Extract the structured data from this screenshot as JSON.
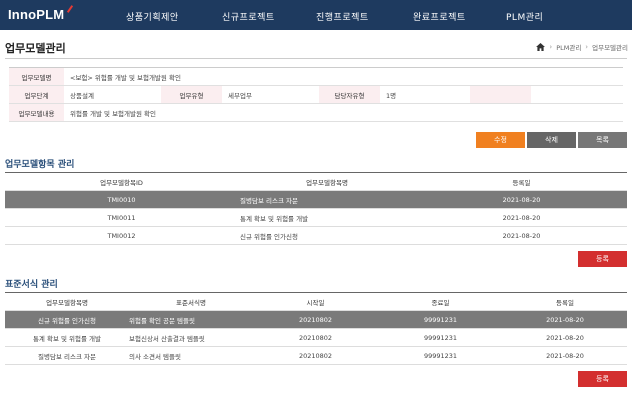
{
  "brand": {
    "logo": "InnoPLM"
  },
  "nav": [
    {
      "label": "상품기획제안"
    },
    {
      "label": "신규프로젝트"
    },
    {
      "label": "진행프로젝트"
    },
    {
      "label": "완료프로젝트"
    },
    {
      "label": "PLM관리"
    }
  ],
  "page": {
    "title": "업무모델관리",
    "breadcrumb": [
      "PLM관리",
      "업무모델관리"
    ]
  },
  "info": {
    "model_name_label": "업무모델명",
    "model_name_value": "<보험> 위험률 개발 및 보험개발원 확인",
    "stage_label": "업무단계",
    "stage_value": "상품설계",
    "type_label": "업무유형",
    "type_value": "세부업무",
    "owner_type_label": "담당자유형",
    "owner_type_value": "1명",
    "content_label": "업무모델내용",
    "content_value": "위험률 개발 및 보험개발원 확인"
  },
  "buttons": {
    "edit": "수정",
    "delete": "삭제",
    "list": "목록",
    "register": "등록"
  },
  "items_section": {
    "title": "업무모델항목 관리",
    "columns": [
      "업무모델항목ID",
      "업무모델항목명",
      "등록일"
    ],
    "rows": [
      [
        "TMI0010",
        "질병담보 리스크 자문",
        "2021-08-20"
      ],
      [
        "TMI0011",
        "통계 확보 및 위험률 개발",
        "2021-08-20"
      ],
      [
        "TMI0012",
        "신규 위험률 인가신청",
        "2021-08-20"
      ]
    ]
  },
  "forms_section": {
    "title": "표준서식 관리",
    "columns": [
      "업무모델항목명",
      "표준서식명",
      "시작일",
      "종료일",
      "등록일"
    ],
    "rows": [
      [
        "신규 위험률 인가신청",
        "위험률 확인 공문 템플릿",
        "20210802",
        "99991231",
        "2021-08-20"
      ],
      [
        "통계 확보 및 위험률 개발",
        "보험신상서 산출결과 템플릿",
        "20210802",
        "99991231",
        "2021-08-20"
      ],
      [
        "질병담보 리스크 자문",
        "의사 소견서 템플릿",
        "20210802",
        "99991231",
        "2021-08-20"
      ]
    ]
  }
}
